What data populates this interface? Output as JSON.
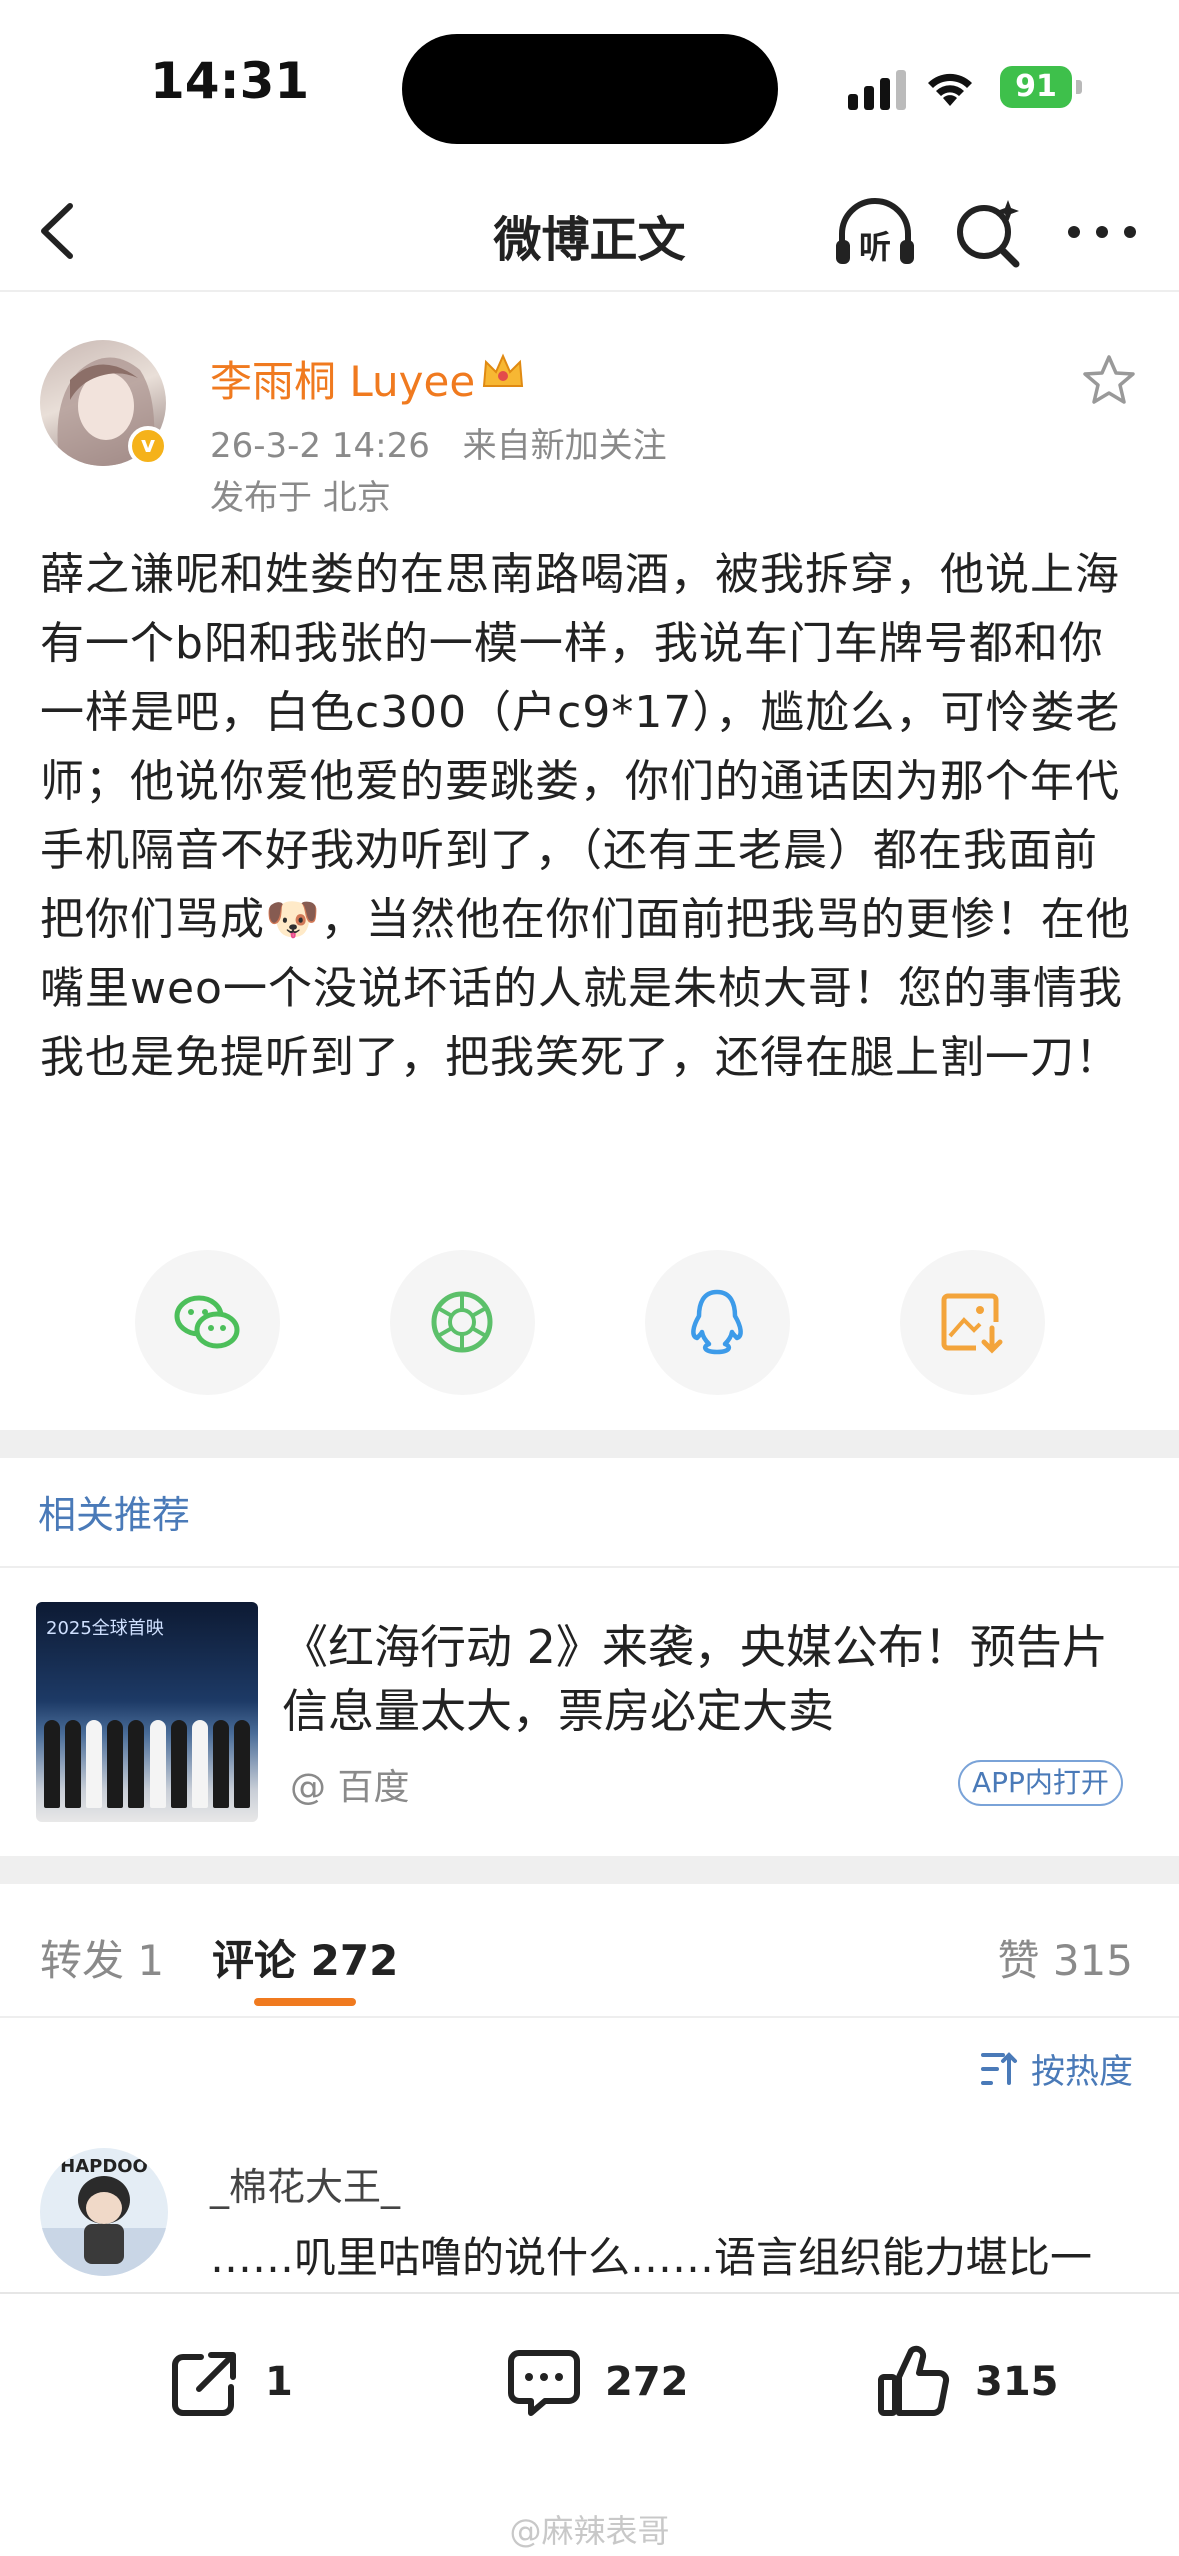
{
  "status_bar": {
    "time": "14:31",
    "battery": "91"
  },
  "nav": {
    "title": "微博正文",
    "listen_label": "听"
  },
  "post": {
    "author": "李雨桐 Luyee",
    "date": "26-3-2 14:26",
    "source": "来自新加关注",
    "location": "发布于 北京",
    "verified_mark": "v",
    "body": "薛之谦呢和姓娄的在思南路喝酒，被我拆穿，他说上海有一个b阳和我张的一模一样，我说车门车牌号都和你一样是吧，白色c300（户c9*17），尴尬么，可怜娄老师；他说你爱他爱的要跳娄，你们的通话因为那个年代手机隔音不好我劝听到了，（还有王老晨）都在我面前把你们骂成🐶，当然他在你们面前把我骂的更惨！在他嘴里weo一个没说坏话的人就是朱桢大哥！您的事情我我也是免提听到了，把我笑死了，还得在腿上割一刀！"
  },
  "share": {
    "items": [
      "wechat-icon",
      "moments-icon",
      "qq-icon",
      "save-image-icon"
    ],
    "colors": {
      "wechat": "#4cbf5a",
      "moments": "#5cc06a",
      "qq": "#3d9be9",
      "save": "#f3a43b"
    }
  },
  "recommend": {
    "title": "相关推荐",
    "thumb_tag": "2025全球首映",
    "headline": "《红海行动 2》来袭，央媒公布！预告片信息量太大，票房必定大卖",
    "source": "@ 百度",
    "app_button": "APP内打开"
  },
  "tabs": {
    "repost": "转发 1",
    "comments": "评论 272",
    "likes": "赞 315",
    "sort": "按热度"
  },
  "comment": {
    "avatar_text": "HAPDOO",
    "name": "_棉花大王_",
    "text": "……叽里咕噜的说什么……语言组织能力堪比一"
  },
  "bottom": {
    "repost_count": "1",
    "comment_count": "272",
    "like_count": "315",
    "watermark": "@麻辣表哥"
  },
  "colors": {
    "accent": "#f07a1f",
    "link": "#4a7ab8",
    "muted": "#8a8a8a"
  }
}
